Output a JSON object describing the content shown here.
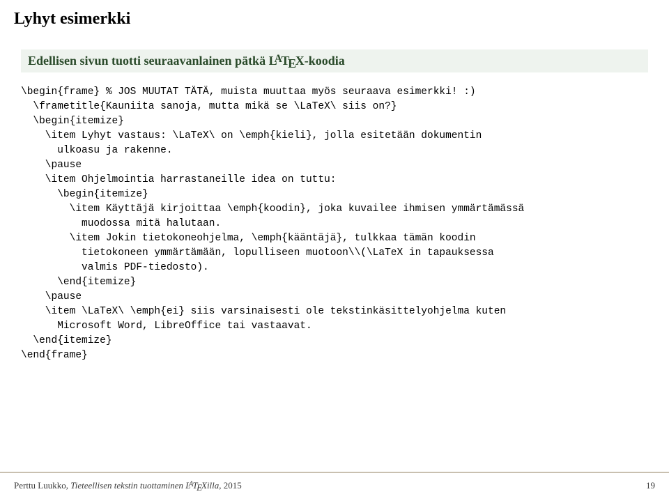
{
  "header": {
    "title": "Lyhyt esimerkki"
  },
  "subtitle": {
    "prefix": "Edellisen sivun tuotti seuraavanlainen pätkä L",
    "A": "A",
    "mid": "T",
    "E": "E",
    "suffix": "X-koodia"
  },
  "code": "\\begin{frame} % JOS MUUTAT TÄTÄ, muista muuttaa myös seuraava esimerkki! :)\n  \\frametitle{Kauniita sanoja, mutta mikä se \\LaTeX\\ siis on?}\n  \\begin{itemize}\n    \\item Lyhyt vastaus: \\LaTeX\\ on \\emph{kieli}, jolla esitetään dokumentin\n      ulkoasu ja rakenne.\n    \\pause\n    \\item Ohjelmointia harrastaneille idea on tuttu:\n      \\begin{itemize}\n        \\item Käyttäjä kirjoittaa \\emph{koodin}, joka kuvailee ihmisen ymmärtämässä\n          muodossa mitä halutaan.\n        \\item Jokin tietokoneohjelma, \\emph{kääntäjä}, tulkkaa tämän koodin\n          tietokoneen ymmärtämään, lopulliseen muotoon\\\\(\\LaTeX in tapauksessa\n          valmis PDF-tiedosto).\n      \\end{itemize}\n    \\pause\n    \\item \\LaTeX\\ \\emph{ei} siis varsinaisesti ole tekstinkäsittelyohjelma kuten\n      Microsoft Word, LibreOffice tai vastaavat.\n  \\end{itemize}\n\\end{frame}",
  "footer": {
    "author": "Perttu Luukko, ",
    "work_prefix": "Tieteellisen tekstin tuottaminen L",
    "A": "A",
    "mid": "T",
    "E": "E",
    "work_suffix": "Xilla,",
    "year": " 2015",
    "page": "19"
  }
}
